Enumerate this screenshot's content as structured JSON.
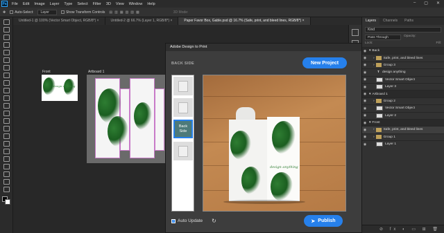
{
  "app": {
    "logo": "Ps"
  },
  "menu": [
    "File",
    "Edit",
    "Image",
    "Layer",
    "Type",
    "Select",
    "Filter",
    "3D",
    "View",
    "Window",
    "Help"
  ],
  "options_bar": {
    "auto_select_label": "Auto-Select:",
    "auto_select_value": "Layer",
    "transform_label": "Show Transform Controls",
    "mode3d": "3D Mode:"
  },
  "doc_tabs": [
    {
      "label": "Untitled-1 @ 100% (Vector Smart Object, RGB/8*) ×",
      "active": false
    },
    {
      "label": "Untitled-2 @ 66.7% (Layer 1, RGB/8*) ×",
      "active": false
    },
    {
      "label": "Paper Favor Box, Gable.psd @ 16.7% (Safe, print, and bleed lines, RGB/8*) ×",
      "active": true
    }
  ],
  "canvas": {
    "front_label": "Front",
    "artboard1_label": "Artboard 1"
  },
  "dialog": {
    "title": "Adobe Design to Print",
    "section_label": "BACK SIDE",
    "new_project_label": "New Project",
    "selected_thumb_label": "Back\nSide",
    "auto_update_label": "Auto Update",
    "publish_label": "Publish",
    "box_text": "design anything"
  },
  "layers_panel": {
    "tabs": [
      "Layers",
      "Channels",
      "Paths"
    ],
    "search_placeholder": "Kind",
    "blend_mode": "Pass Through",
    "opacity_label": "Opacity:",
    "lock_label": "Lock:",
    "fill_label": "Fill:",
    "rows": [
      {
        "label": "Back",
        "type": "artboard"
      },
      {
        "label": "Safe, print, and bleed lines",
        "type": "group"
      },
      {
        "label": "Group 3",
        "type": "group"
      },
      {
        "label": "design anything",
        "type": "layer"
      },
      {
        "label": "Vector Smart Object",
        "type": "layer"
      },
      {
        "label": "Layer 3",
        "type": "layer"
      },
      {
        "label": "Artboard 1",
        "type": "artboard"
      },
      {
        "label": "Group 2",
        "type": "group"
      },
      {
        "label": "Vector Smart Object",
        "type": "layer"
      },
      {
        "label": "Layer 2",
        "type": "layer"
      },
      {
        "label": "Front",
        "type": "artboard"
      },
      {
        "label": "Safe, print, and bleed lines",
        "type": "group"
      },
      {
        "label": "Group 1",
        "type": "group"
      },
      {
        "label": "Layer 1",
        "type": "layer"
      }
    ]
  },
  "colors": {
    "accent": "#2680eb",
    "panel": "#323232",
    "dialog": "#3d3d3d"
  }
}
